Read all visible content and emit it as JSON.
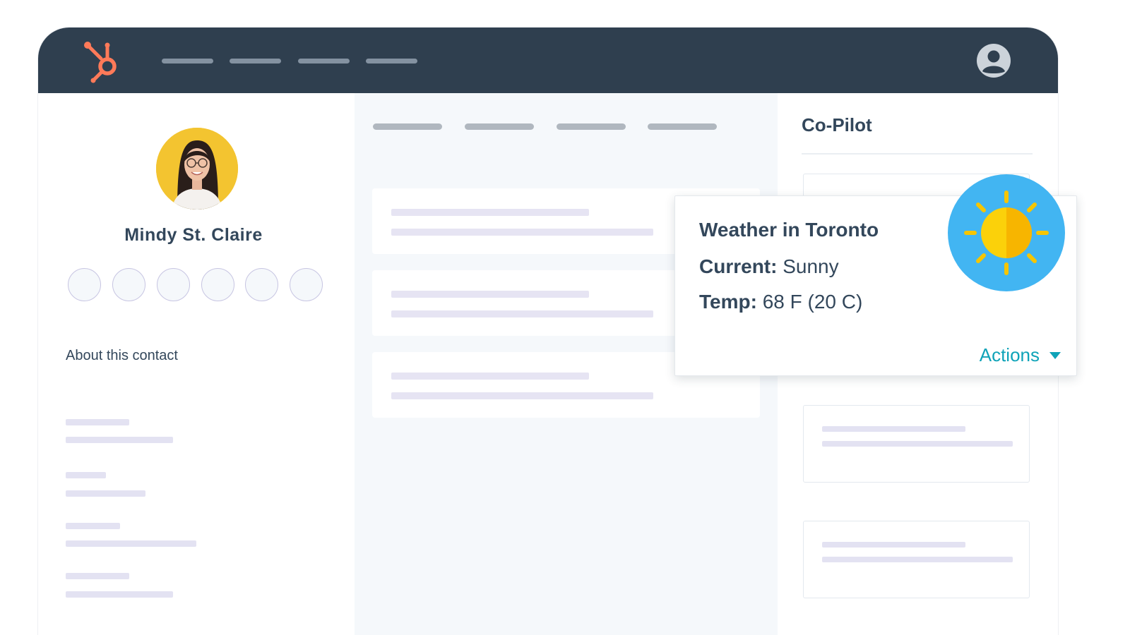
{
  "app": {
    "logo_icon": "hubspot-sprocket-icon",
    "brand_color": "#ff7a59",
    "nav_color": "#2f3f4f"
  },
  "contact": {
    "name": "Mindy St. Claire",
    "about_heading": "About this contact",
    "action_circles": 6
  },
  "copilot": {
    "title": "Co-Pilot"
  },
  "weather": {
    "title": "Weather in Toronto",
    "current_label": "Current:",
    "current_value": "Sunny",
    "temp_label": "Temp:",
    "temp_value": "68 F (20 C)",
    "actions_label": "Actions",
    "icon": "sun-icon",
    "badge_color": "#42b5f2",
    "accent_color": "#0fa3b8"
  }
}
